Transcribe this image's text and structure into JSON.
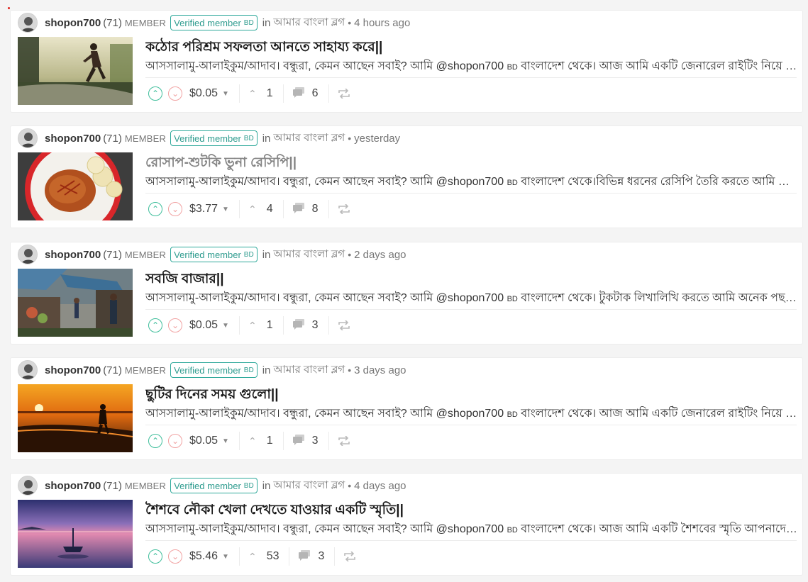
{
  "posts": [
    {
      "author": "shopon700",
      "reputation": "(71)",
      "member_label": "MEMBER",
      "verified": "Verified member",
      "verified_country": "BD",
      "in_label": "in",
      "community": "আমার বাংলা ব্লগ",
      "time_sep": "•",
      "time": "4 hours ago",
      "title": "কঠোর পরিশ্রম সফলতা আনতে সাহায্য করে||",
      "body_pre": "আসসালামু-আলাইকুম/আদাব। বন্ধুরা, কেমন আছেন সবাই? আমি @shopon700",
      "body_bd": "BD",
      "body_post": "বাংলাদেশ থেকে। আজ আমি একটি জেনারেল রাইটিং নিয়ে আপনাদের মাঝে হাজির হয়েছি",
      "payout": "$0.05",
      "votes": "1",
      "comments": "6",
      "thumb_icon": "runner-photo",
      "visited": false
    },
    {
      "author": "shopon700",
      "reputation": "(71)",
      "member_label": "MEMBER",
      "verified": "Verified member",
      "verified_country": "BD",
      "in_label": "in",
      "community": "আমার বাংলা ব্লগ",
      "time_sep": "•",
      "time": "yesterday",
      "title": "রোসাপ-শুটকি ভুনা রেসিপি||",
      "body_pre": "আসসালামু-আলাইকুম/আদাব। বন্ধুরা, কেমন আছেন সবাই? আমি @shopon700",
      "body_bd": "BD",
      "body_post": "বাংলাদেশ থেকে।বিভিন্ন ধরনের রেসিপি তৈরি করতে আমি অনেক পছন্দ করি",
      "payout": "$3.77",
      "votes": "4",
      "comments": "8",
      "thumb_icon": "food-plate-photo",
      "visited": true
    },
    {
      "author": "shopon700",
      "reputation": "(71)",
      "member_label": "MEMBER",
      "verified": "Verified member",
      "verified_country": "BD",
      "in_label": "in",
      "community": "আমার বাংলা ব্লগ",
      "time_sep": "•",
      "time": "2 days ago",
      "title": "সবজি বাজার||",
      "body_pre": "আসসালামু-আলাইকুম/আদাব। বন্ধুরা, কেমন আছেন সবাই? আমি @shopon700",
      "body_bd": "BD",
      "body_post": "বাংলাদেশ থেকে। টুকটাক লিখালিখি করতে আমি অনেক পছন্দ করি",
      "payout": "$0.05",
      "votes": "1",
      "comments": "3",
      "thumb_icon": "market-photo",
      "visited": false
    },
    {
      "author": "shopon700",
      "reputation": "(71)",
      "member_label": "MEMBER",
      "verified": "Verified member",
      "verified_country": "BD",
      "in_label": "in",
      "community": "আমার বাংলা ব্লগ",
      "time_sep": "•",
      "time": "3 days ago",
      "title": "ছুটির দিনের সময় গুলো||",
      "body_pre": "আসসালামু-আলাইকুম/আদাব। বন্ধুরা, কেমন আছেন সবাই? আমি @shopon700",
      "body_bd": "BD",
      "body_post": "বাংলাদেশ থেকে। আজ আমি একটি জেনারেল রাইটিং নিয়ে আপনাদের মাঝে হাজির হয়েছি",
      "payout": "$0.05",
      "votes": "1",
      "comments": "3",
      "thumb_icon": "sunset-beach-photo",
      "visited": false
    },
    {
      "author": "shopon700",
      "reputation": "(71)",
      "member_label": "MEMBER",
      "verified": "Verified member",
      "verified_country": "BD",
      "in_label": "in",
      "community": "আমার বাংলা ব্লগ",
      "time_sep": "•",
      "time": "4 days ago",
      "title": "শৈশবে নৌকা খেলা দেখতে যাওয়ার একটি স্মৃতি||",
      "body_pre": "আসসালামু-আলাইকুম/আদাব। বন্ধুরা, কেমন আছেন সবাই? আমি @shopon700",
      "body_bd": "BD",
      "body_post": "বাংলাদেশ থেকে। আজ আমি একটি শৈশবের স্মৃতি আপনাদের মাঝে শেয়ার করব",
      "payout": "$5.46",
      "votes": "53",
      "comments": "3",
      "thumb_icon": "boat-lake-photo",
      "visited": false
    }
  ],
  "colors": {
    "upvote": "#3fbe9b",
    "downvote": "#f1a2a2",
    "verified_border": "#2fa99b"
  }
}
